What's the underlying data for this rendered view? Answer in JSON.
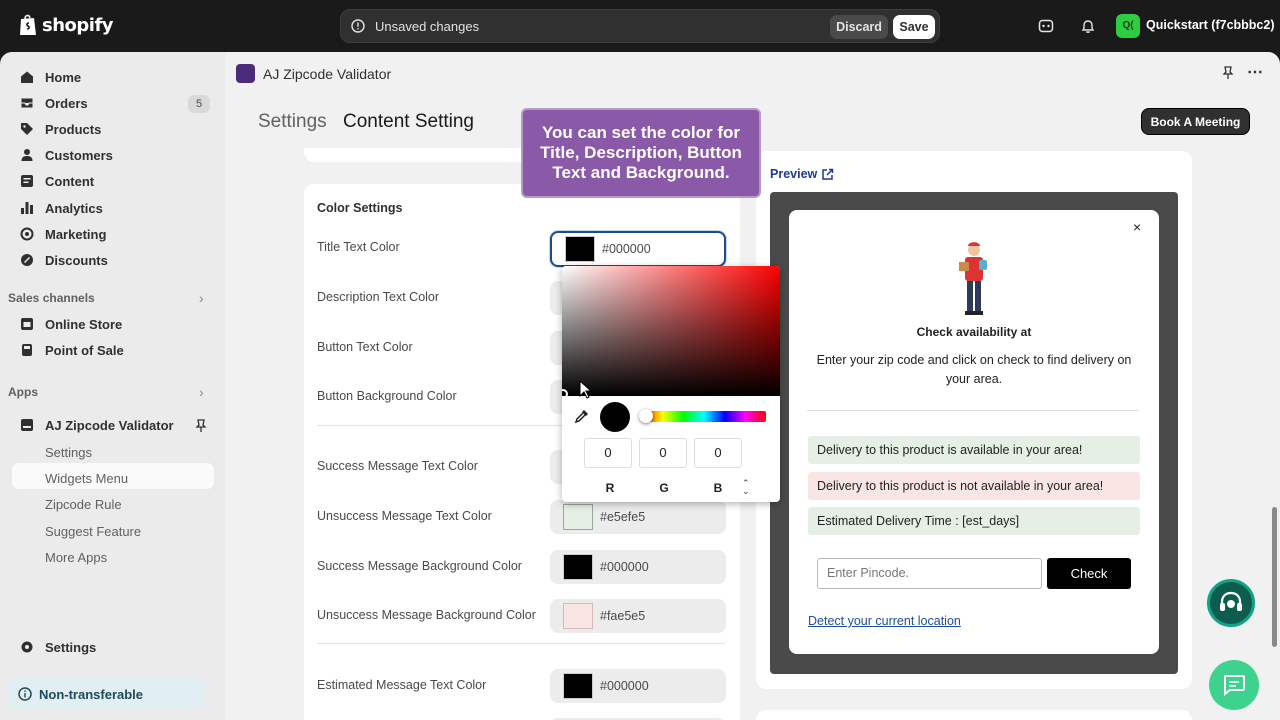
{
  "topbar": {
    "brand": "shopify",
    "unsaved_text": "Unsaved changes",
    "discard_label": "Discard",
    "save_label": "Save",
    "store_initials": "Q(",
    "store_name": "Quickstart (f7cbbbc2)"
  },
  "sidebar": {
    "items": [
      {
        "label": "Home",
        "icon": "home-icon"
      },
      {
        "label": "Orders",
        "icon": "orders-icon",
        "count": "5"
      },
      {
        "label": "Products",
        "icon": "tag-icon"
      },
      {
        "label": "Customers",
        "icon": "person-icon"
      },
      {
        "label": "Content",
        "icon": "content-icon"
      },
      {
        "label": "Analytics",
        "icon": "bar-chart-icon"
      },
      {
        "label": "Marketing",
        "icon": "target-icon"
      },
      {
        "label": "Discounts",
        "icon": "discount-icon"
      }
    ],
    "sales_channels_label": "Sales channels",
    "channels": [
      {
        "label": "Online Store",
        "icon": "store-icon"
      },
      {
        "label": "Point of Sale",
        "icon": "pos-icon"
      }
    ],
    "apps_label": "Apps",
    "app_name": "AJ Zipcode Validator",
    "app_subitems": [
      "Settings",
      "Widgets Menu",
      "Zipcode Rule",
      "Suggest Feature",
      "More Apps"
    ],
    "settings_label": "Settings",
    "nontransferable_label": "Non-transferable"
  },
  "main": {
    "app_title": "AJ Zipcode Validator",
    "breadcrumb_parent": "Settings",
    "breadcrumb_current": "Content Setting",
    "book_meeting_label": "Book A Meeting",
    "tooltip": "You can set the color for Title, Description, Button Text and Background.",
    "color_settings": {
      "title": "Color Settings",
      "rows": [
        {
          "label": "Title Text Color",
          "value": "#000000",
          "swatch": "#000000"
        },
        {
          "label": "Description Text Color",
          "value": "",
          "swatch": ""
        },
        {
          "label": "Button Text Color",
          "value": "",
          "swatch": ""
        },
        {
          "label": "Button Background Color",
          "value": "",
          "swatch": ""
        },
        {
          "label": "Success Message Text Color",
          "value": "",
          "swatch": ""
        },
        {
          "label": "Unsuccess Message Text Color",
          "value": "#e5efe5",
          "swatch": "#e5efe5"
        },
        {
          "label": "Success Message Background Color",
          "value": "#000000",
          "swatch": "#000000"
        },
        {
          "label": "Unsuccess Message Background Color",
          "value": "#fae5e5",
          "swatch": "#fae5e5"
        },
        {
          "label": "Estimated Message Text Color",
          "value": "#000000",
          "swatch": "#000000"
        }
      ]
    },
    "picker": {
      "r": "0",
      "g": "0",
      "b": "0",
      "r_label": "R",
      "g_label": "G",
      "b_label": "B",
      "toggle": "⌃⌄"
    },
    "preview": {
      "label": "Preview",
      "close": "×",
      "title": "Check availability at",
      "description": "Enter your zip code and click on check to find delivery on your area.",
      "msg_success": "Delivery to this product is available in your area!",
      "msg_fail": "Delivery to this product is not available in your area!",
      "msg_estimate": "Estimated Delivery Time : [est_days]",
      "input_placeholder": "Enter Pincode.",
      "check_label": "Check",
      "location_link": "Detect your current location",
      "colors": {
        "success_bg": "#e5efe5",
        "fail_bg": "#fae5e5",
        "estimate_bg": "#e5efe5"
      }
    }
  }
}
